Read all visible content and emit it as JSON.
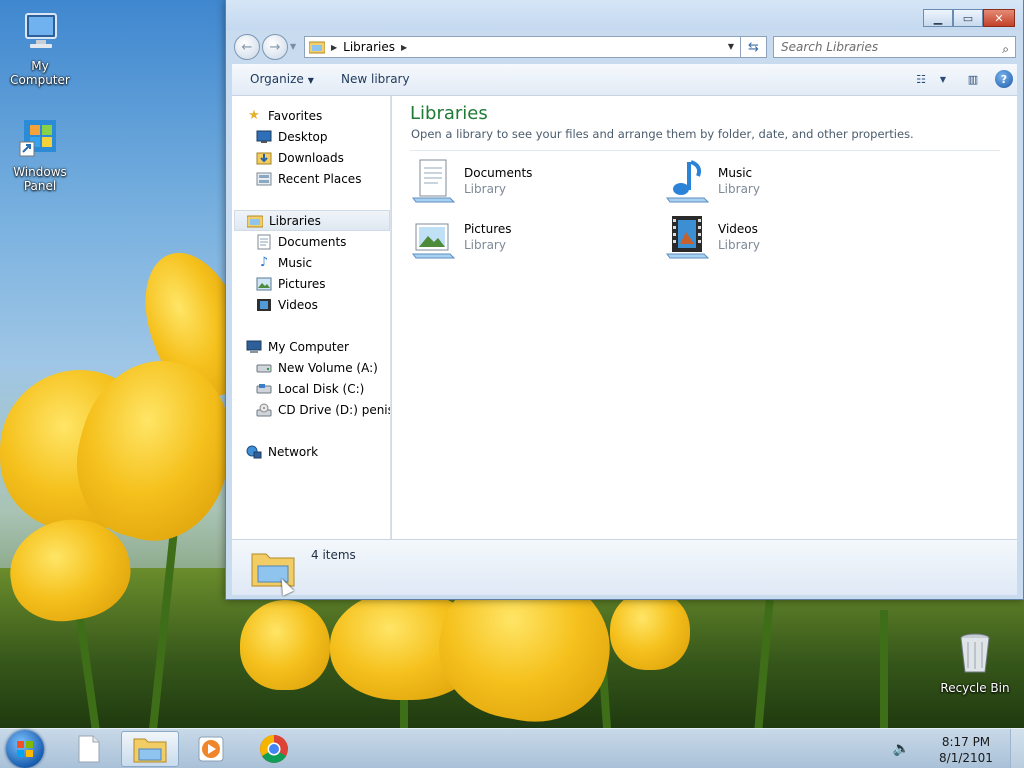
{
  "desktop": {
    "icons": [
      {
        "label": "My Computer",
        "icon": "computer-icon"
      },
      {
        "label": "Windows Panel",
        "icon": "windows-panel-icon"
      },
      {
        "label": "Recycle Bin",
        "icon": "recycle-bin-icon"
      }
    ]
  },
  "window": {
    "address": {
      "crumbs": [
        "Libraries"
      ]
    },
    "search": {
      "placeholder": "Search Libraries"
    },
    "toolbar": {
      "organize_label": "Organize",
      "new_library_label": "New library"
    },
    "nav": {
      "favorites": {
        "label": "Favorites",
        "items": [
          "Desktop",
          "Downloads",
          "Recent Places"
        ]
      },
      "libraries": {
        "label": "Libraries",
        "items": [
          "Documents",
          "Music",
          "Pictures",
          "Videos"
        ]
      },
      "computer": {
        "label": "My Computer",
        "items": [
          "New Volume (A:)",
          "Local Disk (C:)",
          "CD Drive (D:) penisb"
        ]
      },
      "network": {
        "label": "Network"
      }
    },
    "content": {
      "title": "Libraries",
      "subtitle": "Open a library to see your files and arrange them by folder, date, and other properties.",
      "libraries": [
        {
          "name": "Documents",
          "type": "Library"
        },
        {
          "name": "Music",
          "type": "Library"
        },
        {
          "name": "Pictures",
          "type": "Library"
        },
        {
          "name": "Videos",
          "type": "Library"
        }
      ]
    },
    "details": {
      "count": "4 items"
    }
  },
  "taskbar": {
    "time": "8:17 PM",
    "date": "8/1/2101",
    "apps": [
      "file-icon",
      "explorer-icon",
      "media-player-icon",
      "chrome-icon"
    ]
  },
  "colors": {
    "title_green": "#1e7a34",
    "accent_blue": "#1c5aa6",
    "close_red": "#c3412a"
  }
}
